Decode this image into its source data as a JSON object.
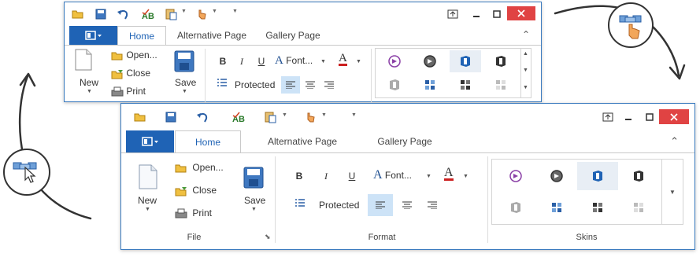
{
  "ribbon": {
    "tabs": [
      "Home",
      "Alternative Page",
      "Gallery Page"
    ],
    "file": {
      "new_label": "New",
      "open_label": "Open...",
      "close_label": "Close",
      "print_label": "Print",
      "save_label": "Save",
      "group_label": "File"
    },
    "format": {
      "font_label": "Font...",
      "protected_label": "Protected",
      "group_label": "Format",
      "bold_glyph": "B",
      "italic_glyph": "I",
      "underline_glyph": "U",
      "font_glyph": "A",
      "color_glyph": "A"
    },
    "skins": {
      "group_label": "Skins"
    }
  },
  "colors": {
    "accent": "#1f63b5",
    "close_button": "#e04343",
    "selected_align": "#cde3f7"
  },
  "icons": {
    "qat": [
      "open-folder-icon",
      "save-disk-icon",
      "undo-icon",
      "spell-check-icon",
      "paste-icon",
      "touch-hand-icon",
      "customize-qat-icon"
    ],
    "window_controls": [
      "restore-ribbon-icon",
      "minimize-icon",
      "maximize-icon",
      "close-icon"
    ],
    "skins": [
      "visual-studio-purple-skin-icon",
      "visual-studio-dark-skin-icon",
      "office-blue-skin-icon",
      "office-black-skin-icon",
      "office-gray-skin-icon",
      "blue-tiles-skin-icon",
      "dark-tiles-skin-icon",
      "light-tiles-skin-icon"
    ]
  }
}
